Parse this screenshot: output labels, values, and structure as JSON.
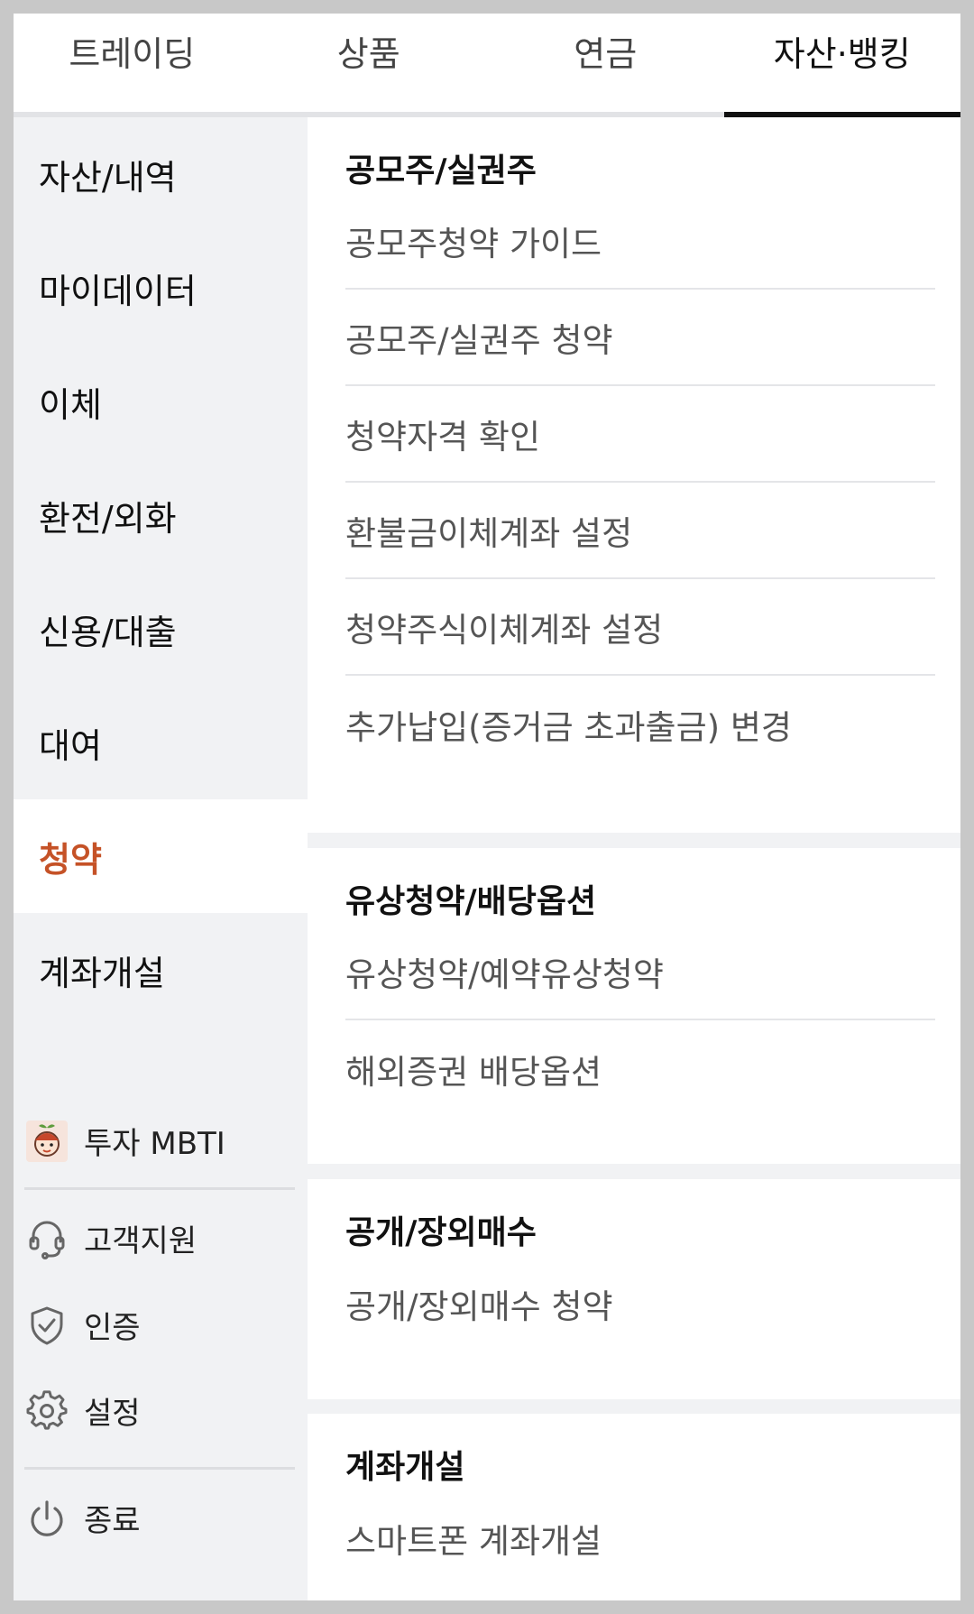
{
  "tabs": [
    {
      "label": "트레이딩"
    },
    {
      "label": "상품"
    },
    {
      "label": "연금"
    },
    {
      "label": "자산·뱅킹"
    }
  ],
  "sidenav": {
    "items": [
      {
        "label": "자산/내역"
      },
      {
        "label": "마이데이터"
      },
      {
        "label": "이체"
      },
      {
        "label": "환전/외화"
      },
      {
        "label": "신용/대출"
      },
      {
        "label": "대여"
      },
      {
        "label": "청약"
      },
      {
        "label": "계좌개설"
      }
    ],
    "active_item": "청약"
  },
  "utilities": {
    "mbti_label": "투자 MBTI",
    "support_label": "고객지원",
    "auth_label": "인증",
    "settings_label": "설정",
    "exit_label": "종료"
  },
  "sections": [
    {
      "title": "공모주/실권주",
      "items": [
        "공모주청약 가이드",
        "공모주/실권주 청약",
        "청약자격 확인",
        "환불금이체계좌 설정",
        "청약주식이체계좌 설정",
        "추가납입(증거금 초과출금) 변경"
      ]
    },
    {
      "title": "유상청약/배당옵션",
      "items": [
        "유상청약/예약유상청약",
        "해외증권 배당옵션"
      ]
    },
    {
      "title": "공개/장외매수",
      "items": [
        "공개/장외매수 청약"
      ]
    },
    {
      "title": "계좌개설",
      "items": [
        "스마트폰 계좌개설"
      ]
    }
  ],
  "colors": {
    "active_accent": "#c55227",
    "nav_background": "#f1f2f4",
    "divider": "#e4e5e8"
  }
}
